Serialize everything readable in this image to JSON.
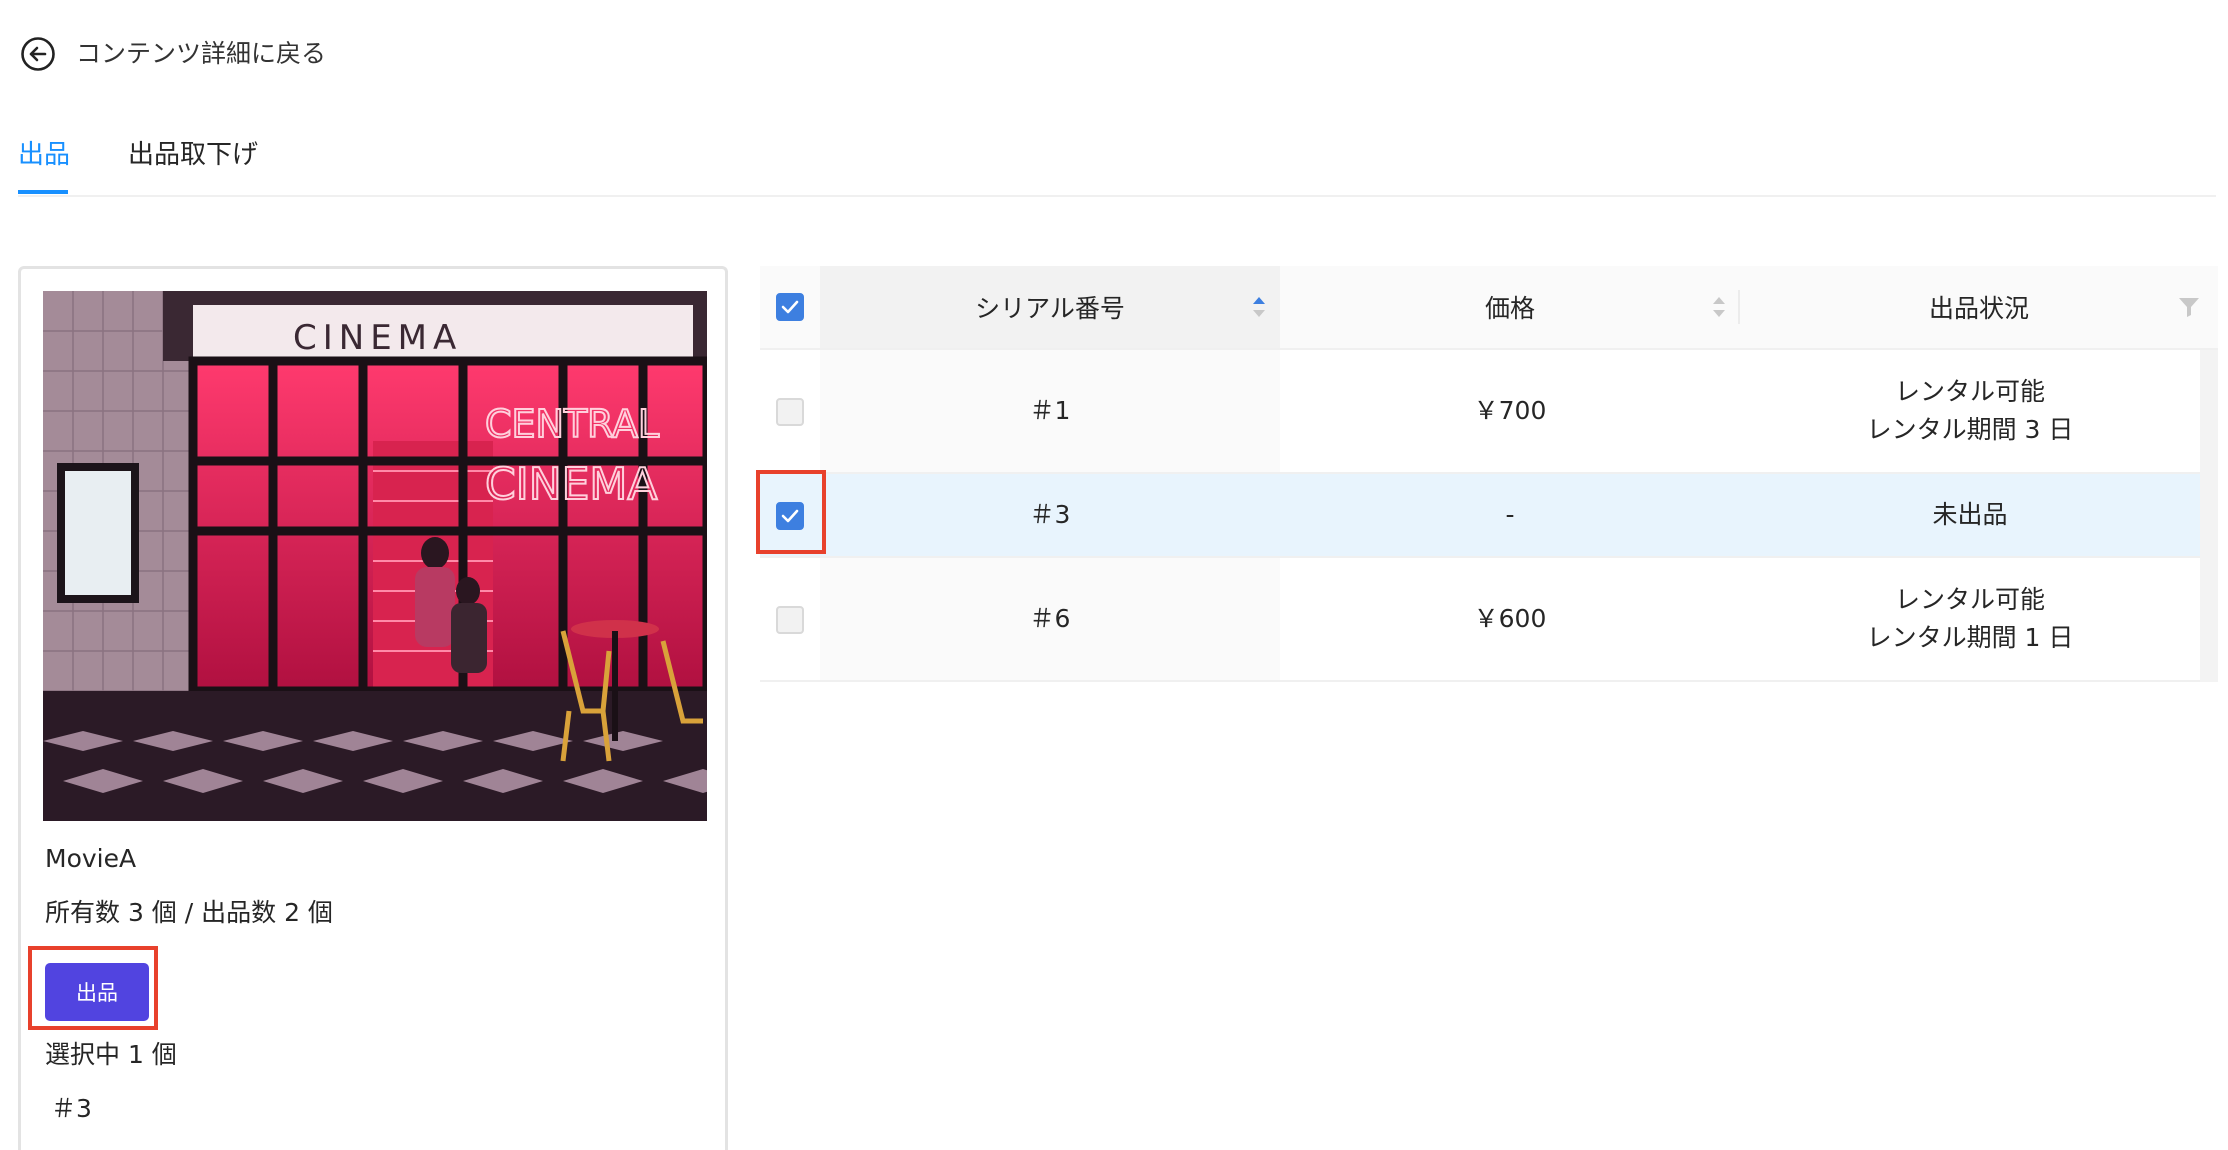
{
  "back_link": {
    "label": "コンテンツ詳細に戻る",
    "icon": "arrow-left-circle-icon"
  },
  "tabs": [
    {
      "label": "出品",
      "active": true
    },
    {
      "label": "出品取下げ",
      "active": false
    }
  ],
  "card": {
    "image_alt": "cinema storefront photo",
    "image_sign_text": "CINEMA",
    "image_neon_text": [
      "CENTRAL",
      "CINEMA"
    ],
    "title": "MovieA",
    "counts": "所有数 3 個 / 出品数 2 個",
    "button_label": "出品",
    "selected_text": "選択中 1 個",
    "selected_serial": "＃3"
  },
  "table": {
    "header_checked": true,
    "columns": [
      {
        "label": "シリアル番号",
        "sortable": true,
        "sort_active": "asc"
      },
      {
        "label": "価格",
        "sortable": true
      },
      {
        "label": "出品状況",
        "filterable": true
      }
    ],
    "rows": [
      {
        "checked": false,
        "serial": "＃1",
        "price": "￥700",
        "status_line1": "レンタル可能",
        "status_line2": "レンタル期間 3 日"
      },
      {
        "checked": true,
        "serial": "＃3",
        "price": "-",
        "status_line1": "未出品",
        "status_line2": ""
      },
      {
        "checked": false,
        "serial": "＃6",
        "price": "￥600",
        "status_line1": "レンタル可能",
        "status_line2": "レンタル期間 1 日"
      }
    ]
  },
  "colors": {
    "accent": "#1890ff",
    "button": "#5144e0",
    "checkbox": "#3d7fe0",
    "selected_row": "#e8f4fd",
    "highlight": "#e8412c"
  }
}
